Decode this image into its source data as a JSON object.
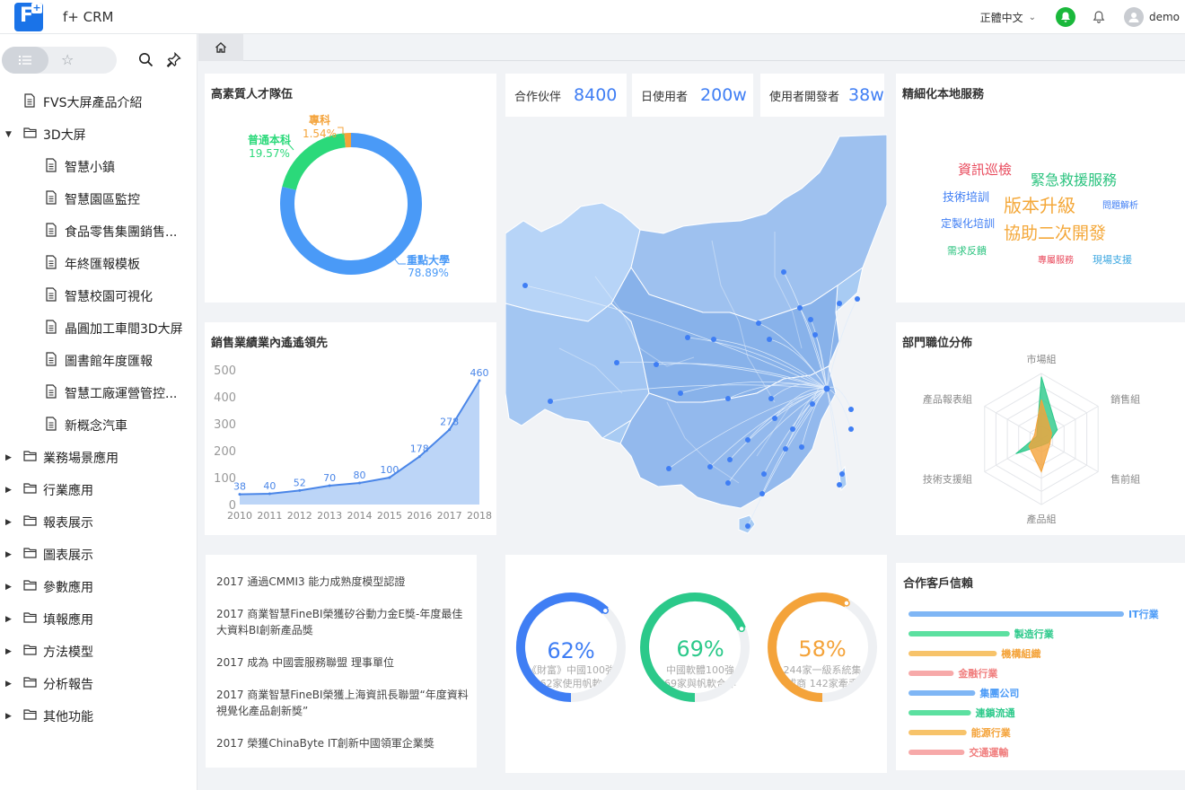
{
  "app": {
    "title": "f+ CRM",
    "language": "正體中文",
    "user": "demo"
  },
  "sidebar": {
    "items": [
      {
        "label": "FVS大屏產品介紹",
        "level": 0,
        "type": "file"
      },
      {
        "label": "3D大屏",
        "level": 0,
        "type": "folder",
        "expanded": true
      },
      {
        "label": "智慧小鎮",
        "level": 1,
        "type": "file"
      },
      {
        "label": "智慧園區監控",
        "level": 1,
        "type": "file"
      },
      {
        "label": "食品零售集團銷售...",
        "level": 1,
        "type": "file"
      },
      {
        "label": "年終匯報模板",
        "level": 1,
        "type": "file"
      },
      {
        "label": "智慧校園可視化",
        "level": 1,
        "type": "file"
      },
      {
        "label": "晶圓加工車間3D大屏",
        "level": 1,
        "type": "file"
      },
      {
        "label": "圖書館年度匯報",
        "level": 1,
        "type": "file"
      },
      {
        "label": "智慧工廠運營管控...",
        "level": 1,
        "type": "file"
      },
      {
        "label": "新概念汽車",
        "level": 1,
        "type": "file"
      },
      {
        "label": "業務場景應用",
        "level": 0,
        "type": "folder"
      },
      {
        "label": "行業應用",
        "level": 0,
        "type": "folder"
      },
      {
        "label": "報表展示",
        "level": 0,
        "type": "folder"
      },
      {
        "label": "圖表展示",
        "level": 0,
        "type": "folder"
      },
      {
        "label": "參數應用",
        "level": 0,
        "type": "folder"
      },
      {
        "label": "填報應用",
        "level": 0,
        "type": "folder"
      },
      {
        "label": "方法模型",
        "level": 0,
        "type": "folder"
      },
      {
        "label": "分析報告",
        "level": 0,
        "type": "folder"
      },
      {
        "label": "其他功能",
        "level": 0,
        "type": "folder"
      }
    ]
  },
  "cards": {
    "talent": {
      "title": "高素質人才隊伍"
    },
    "sales": {
      "title": "銷售業績業內遙遙領先"
    },
    "local": {
      "title": "精細化本地服務"
    },
    "dept": {
      "title": "部門職位分佈"
    },
    "clients": {
      "title": "合作客戶信賴"
    }
  },
  "kpis": [
    {
      "label": "合作伙伴",
      "value": "8400"
    },
    {
      "label": "日使用者",
      "value": "200w"
    },
    {
      "label": "使用者開發者",
      "value": "38w"
    }
  ],
  "word_cloud": [
    {
      "text": "資訊巡檢",
      "color": "#e8475a"
    },
    {
      "text": "緊急救援服務",
      "color": "#2bc37f"
    },
    {
      "text": "技術培訓",
      "color": "#3f7ef4"
    },
    {
      "text": "版本升級",
      "color": "#f4a83a"
    },
    {
      "text": "問題解析",
      "color": "#3f7ef4"
    },
    {
      "text": "定製化培訓",
      "color": "#3f7ef4"
    },
    {
      "text": "協助二次開發",
      "color": "#f4a83a"
    },
    {
      "text": "需求反饋",
      "color": "#2bc37f"
    },
    {
      "text": "專屬服務",
      "color": "#e8475a"
    },
    {
      "text": "現場支援",
      "color": "#3aa6e0"
    }
  ],
  "news": [
    "2017 通過CMMI3 能力成熟度模型認證",
    "2017 商業智慧FineBI榮獲矽谷動力金E獎-年度最佳大資料BI創新產品獎",
    "2017 成為 中國雲服務聯盟 理事單位",
    "2017 商業智慧FineBI榮獲上海資訊長聯盟“年度資料視覺化產品創新獎”",
    "2017 榮獲ChinaByte IT創新中國領軍企業獎"
  ],
  "gauges": [
    {
      "percent_label": "62%",
      "value": 0.62,
      "line1": "《財富》中國100強",
      "line2": "62家使用帆軟",
      "color": "#3f7ef4"
    },
    {
      "percent_label": "69%",
      "value": 0.69,
      "line1": "中國軟體100強",
      "line2": "69家與帆軟合作",
      "color": "#2bc98a"
    },
    {
      "percent_label": "58%",
      "value": 0.58,
      "line1": "244家一級系統集",
      "line2": "成商 142家牽手",
      "color": "#f4a33a"
    }
  ],
  "chart_data": [
    {
      "type": "pie",
      "title": "高素質人才隊伍",
      "categories": [
        "重點大學",
        "普通本科",
        "專科"
      ],
      "values": [
        78.89,
        19.57,
        1.54
      ],
      "labels": [
        "78.89%",
        "19.57%",
        "1.54%"
      ],
      "colors": [
        "#4a9af7",
        "#2bd97a",
        "#f4a33a"
      ]
    },
    {
      "type": "area",
      "title": "銷售業績業內遙遙領先",
      "x": [
        "2010",
        "2011",
        "2012",
        "2013",
        "2014",
        "2015",
        "2016",
        "2017",
        "2018"
      ],
      "values": [
        38,
        40,
        52,
        70,
        80,
        100,
        178,
        278,
        460
      ],
      "y_ticks": [
        "0",
        "100",
        "200",
        "300",
        "400",
        "500"
      ],
      "ylim": [
        0,
        500
      ],
      "color": "#4a86e8"
    },
    {
      "type": "radar",
      "title": "部門職位分佈",
      "categories": [
        "市場組",
        "銷售組",
        "售前組",
        "產品組",
        "技術支援組",
        "產品報表組"
      ],
      "series": [
        {
          "values": [
            95,
            28,
            12,
            10,
            45,
            8
          ],
          "color": "#2bc98a"
        },
        {
          "values": [
            60,
            18,
            15,
            50,
            22,
            12
          ],
          "color": "#f4a33a"
        }
      ],
      "max": 100
    },
    {
      "type": "bar",
      "title": "合作客戶信賴",
      "categories": [
        "IT行業",
        "製造行業",
        "機構組織",
        "金融行業",
        "集團公司",
        "連鎖流通",
        "能源行業",
        "交通運輸"
      ],
      "values": [
        100,
        47,
        41,
        21,
        31,
        29,
        27,
        26
      ],
      "colors": [
        "#7fb6f5",
        "#5ce0a0",
        "#f7c36a",
        "#f7a9a9",
        "#7fb6f5",
        "#5ce0a0",
        "#f7c36a",
        "#f7a9a9"
      ],
      "label_colors": [
        "#4a9af7",
        "#2bc98a",
        "#f4a33a",
        "#f07d7d",
        "#4a9af7",
        "#2bc98a",
        "#f4a33a",
        "#f07d7d"
      ]
    }
  ]
}
